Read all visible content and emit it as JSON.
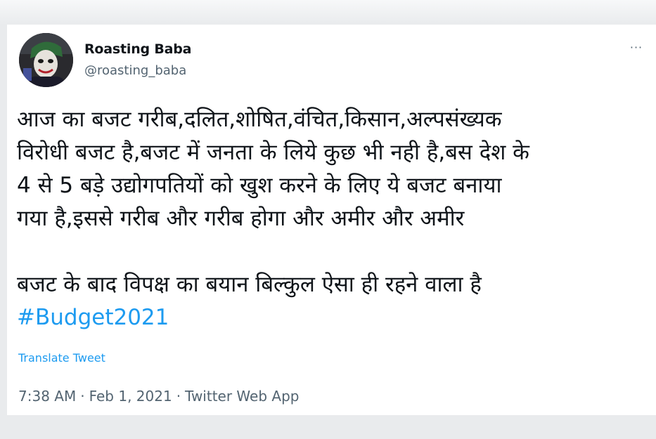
{
  "tweet": {
    "author": {
      "display_name": "Roasting Baba",
      "handle": "@roasting_baba",
      "avatar_icon": "joker-avatar-icon"
    },
    "more_icon": "more-horizontal-icon",
    "more_label": "···",
    "text_lines": [
      "आज का बजट गरीब,दलित,शोषित,वंचित,किसान,अल्पसंख्यक",
      "विरोधी बजट है,बजट में जनता के लिये कुछ भी नही है,बस देश के",
      "4 से 5 बड़े उद्योगपतियों को खुश करने के लिए ये बजट बनाया",
      "गया है,इससे गरीब और गरीब होगा और अमीर और अमीर",
      "",
      "बजट के बाद विपक्ष का बयान बिल्कुल ऐसा ही रहने वाला है"
    ],
    "hashtag": "#Budget2021",
    "translate_label": "Translate Tweet",
    "time": "7:38 AM",
    "date": "Feb 1, 2021",
    "separator": "·",
    "source": "Twitter Web App"
  },
  "colors": {
    "link": "#1d9bf0",
    "text": "#0f1419",
    "secondary": "#536471",
    "card_bg": "#ffffff",
    "page_bg": "#e9ebed"
  }
}
